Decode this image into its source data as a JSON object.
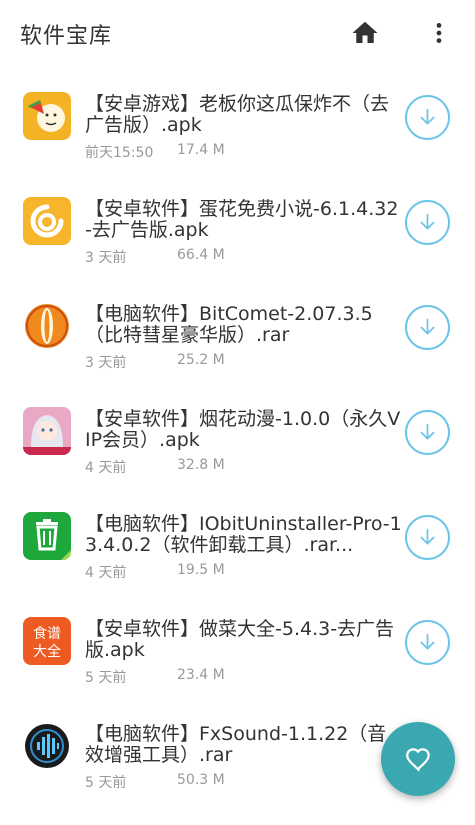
{
  "appbar": {
    "title": "软件宝库",
    "home_icon": "home-icon",
    "more_icon": "more-vertical-icon"
  },
  "items": [
    {
      "name": "【安卓游戏】老板你这瓜保炸不（去广告版）.apk",
      "date": "前天15:50",
      "size": "17.4 M",
      "icon": "watermelon-meme-icon",
      "icon_color": "#f4b324"
    },
    {
      "name": "【安卓软件】蛋花免费小说-6.1.4.32-去广告版.apk",
      "date": "3 天前",
      "size": "66.4 M",
      "icon": "danhua-novel-icon",
      "icon_color": "#f7b52c"
    },
    {
      "name": "【电脑软件】BitComet-2.07.3.5（比特彗星豪华版）.rar",
      "date": "3 天前",
      "size": "25.2 M",
      "icon": "bitcomet-icon",
      "icon_color": "#f08a1e"
    },
    {
      "name": "【安卓软件】烟花动漫-1.0.0（永久VIP会员）.apk",
      "date": "4 天前",
      "size": "32.8 M",
      "icon": "anime-girl-icon",
      "icon_color": "#d64560"
    },
    {
      "name": "【电脑软件】IObitUninstaller-Pro-13.4.0.2（软件卸载工具）.rar...",
      "date": "4 天前",
      "size": "19.5 M",
      "icon": "trash-uninstaller-icon",
      "icon_color": "#1ea83c"
    },
    {
      "name": "【安卓软件】做菜大全-5.4.3-去广告版.apk",
      "date": "5 天前",
      "size": "23.4 M",
      "icon": "recipe-icon",
      "icon_color": "#ee5b22",
      "icon_text": "食谱大全"
    },
    {
      "name": "【电脑软件】FxSound-1.1.22（音效增强工具）.rar",
      "date": "5 天前",
      "size": "50.3 M",
      "icon": "fxsound-icon",
      "icon_color": "#222222"
    }
  ],
  "fab": {
    "icon": "heart-icon",
    "color": "#3aa8b0"
  },
  "accent": "#6cc4e8"
}
